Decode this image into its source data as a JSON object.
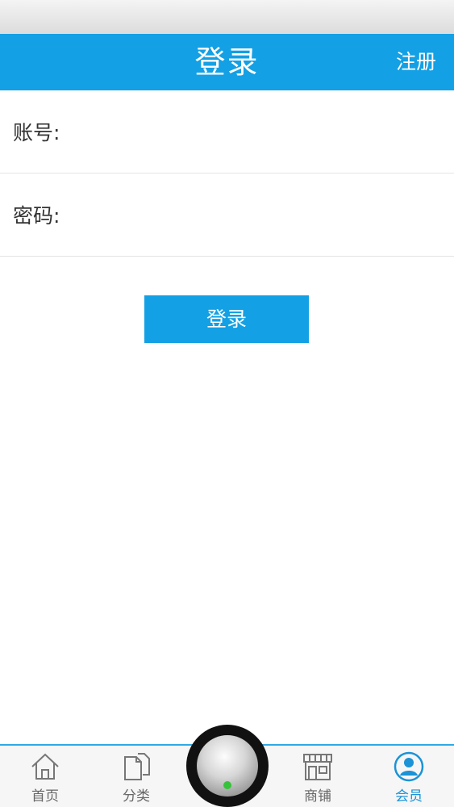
{
  "header": {
    "title": "登录",
    "register_label": "注册"
  },
  "form": {
    "account_label": "账号:",
    "account_value": "",
    "password_label": "密码:",
    "password_value": "",
    "login_button": "登录"
  },
  "tabbar": {
    "items": [
      {
        "label": "首页",
        "icon": "home-icon",
        "active": false
      },
      {
        "label": "分类",
        "icon": "category-icon",
        "active": false
      },
      {
        "label": "商铺",
        "icon": "shop-icon",
        "active": false
      },
      {
        "label": "会员",
        "icon": "member-icon",
        "active": true
      }
    ],
    "center_button_icon": "knob-icon"
  },
  "colors": {
    "accent": "#13a0e4",
    "active_tab": "#1b93d6",
    "indicator_dot": "#36c33a"
  }
}
